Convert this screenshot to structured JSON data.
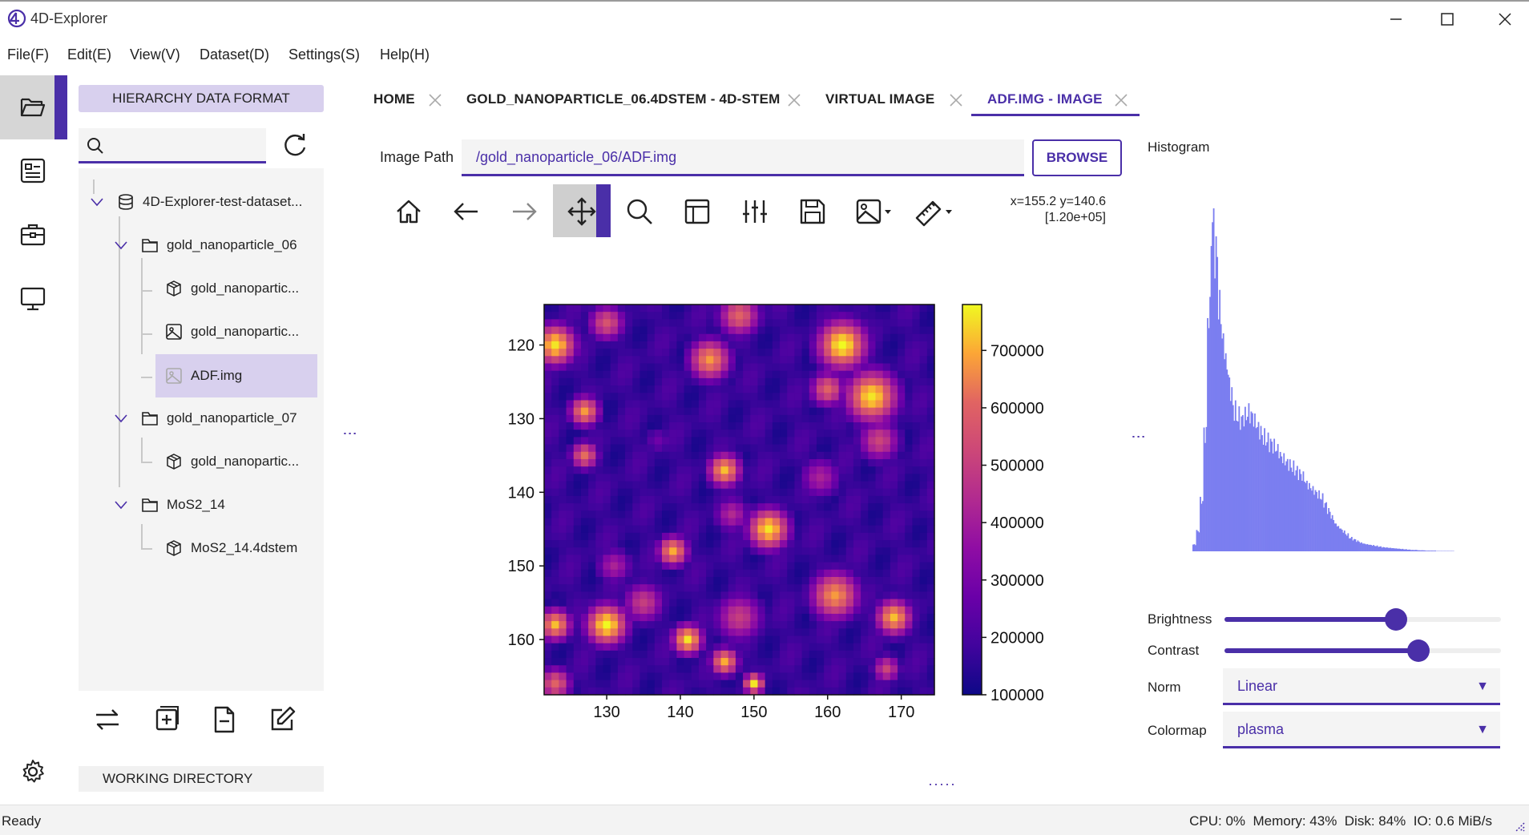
{
  "window": {
    "title": "4D-Explorer",
    "logo": "4D"
  },
  "menu": [
    "File(F)",
    "Edit(E)",
    "View(V)",
    "Dataset(D)",
    "Settings(S)",
    "Help(H)"
  ],
  "left_panel": {
    "header": "HIERARCHY DATA FORMAT",
    "search_placeholder": "",
    "working_dir": "WORKING DIRECTORY",
    "tree": [
      {
        "label": "4D-Explorer-test-dataset...",
        "icon": "database-icon",
        "level": 0
      },
      {
        "label": "gold_nanoparticle_06",
        "icon": "folder-icon",
        "level": 1
      },
      {
        "label": "gold_nanopartic...",
        "icon": "cube-icon",
        "level": 2
      },
      {
        "label": "gold_nanopartic...",
        "icon": "image-icon",
        "level": 2
      },
      {
        "label": "ADF.img",
        "icon": "image-icon",
        "level": 2,
        "selected": true
      },
      {
        "label": "gold_nanoparticle_07",
        "icon": "folder-icon",
        "level": 1
      },
      {
        "label": "gold_nanopartic...",
        "icon": "cube-icon",
        "level": 2
      },
      {
        "label": "MoS2_14",
        "icon": "folder-icon",
        "level": 1
      },
      {
        "label": "MoS2_14.4dstem",
        "icon": "cube-icon",
        "level": 2
      }
    ]
  },
  "tabs": [
    {
      "label": "HOME"
    },
    {
      "label": "GOLD_NANOPARTICLE_06.4DSTEM - 4D-STEM"
    },
    {
      "label": "VIRTUAL IMAGE"
    },
    {
      "label": "ADF.IMG - IMAGE",
      "active": true
    }
  ],
  "image_path": {
    "label": "Image Path",
    "value": "/gold_nanoparticle_06/ADF.img",
    "browse": "BROWSE"
  },
  "toolbar": {
    "icons": [
      "home-icon",
      "back-icon",
      "forward-icon",
      "pan-icon",
      "zoom-icon",
      "subplots-icon",
      "customize-icon",
      "save-icon",
      "image-icon",
      "ruler-icon"
    ],
    "coords_line1": "x=155.2 y=140.6",
    "coords_line2": "[1.20e+05]"
  },
  "chart_data": {
    "type": "heatmap",
    "title": "",
    "colormap": "plasma",
    "x_ticks": [
      130,
      140,
      150,
      160,
      170
    ],
    "y_ticks": [
      120,
      130,
      140,
      150,
      160
    ],
    "xlim": [
      121.5,
      174.5
    ],
    "ylim": [
      114.5,
      167.5
    ],
    "colorbar_ticks": [
      100000,
      200000,
      300000,
      400000,
      500000,
      600000,
      700000
    ],
    "colorbar_tick_labels": [
      "100000",
      "200000",
      "300000",
      "400000",
      "500000",
      "600000",
      "700000"
    ],
    "colorbar_range": [
      100000,
      780000
    ],
    "blobs": [
      {
        "x": 123,
        "y": 120,
        "r": 3,
        "v": 760000
      },
      {
        "x": 130,
        "y": 117,
        "r": 2.6,
        "v": 560000
      },
      {
        "x": 127,
        "y": 129,
        "r": 2.2,
        "v": 680000
      },
      {
        "x": 127,
        "y": 135,
        "r": 2,
        "v": 620000
      },
      {
        "x": 144,
        "y": 122,
        "r": 3,
        "v": 680000
      },
      {
        "x": 148,
        "y": 116,
        "r": 3,
        "v": 600000
      },
      {
        "x": 162,
        "y": 120,
        "r": 3.6,
        "v": 780000
      },
      {
        "x": 166,
        "y": 127,
        "r": 3.8,
        "v": 760000
      },
      {
        "x": 160,
        "y": 126,
        "r": 2.5,
        "v": 600000
      },
      {
        "x": 167,
        "y": 133,
        "r": 3,
        "v": 520000
      },
      {
        "x": 146,
        "y": 137,
        "r": 2.4,
        "v": 720000
      },
      {
        "x": 152,
        "y": 145,
        "r": 3,
        "v": 760000
      },
      {
        "x": 147,
        "y": 143,
        "r": 2.6,
        "v": 440000
      },
      {
        "x": 139,
        "y": 148,
        "r": 2.2,
        "v": 700000
      },
      {
        "x": 135,
        "y": 155,
        "r": 3,
        "v": 500000
      },
      {
        "x": 131,
        "y": 150,
        "r": 2.6,
        "v": 420000
      },
      {
        "x": 130,
        "y": 158,
        "r": 3,
        "v": 780000
      },
      {
        "x": 141,
        "y": 160,
        "r": 2.2,
        "v": 760000
      },
      {
        "x": 148,
        "y": 157,
        "r": 3.5,
        "v": 500000
      },
      {
        "x": 146,
        "y": 163,
        "r": 2,
        "v": 700000
      },
      {
        "x": 161,
        "y": 154,
        "r": 3.5,
        "v": 680000
      },
      {
        "x": 169,
        "y": 157,
        "r": 2.6,
        "v": 720000
      },
      {
        "x": 168,
        "y": 164,
        "r": 2,
        "v": 520000
      },
      {
        "x": 123,
        "y": 158,
        "r": 2.3,
        "v": 720000
      },
      {
        "x": 123,
        "y": 166,
        "r": 2.3,
        "v": 600000
      },
      {
        "x": 137,
        "y": 133,
        "r": 2.2,
        "v": 280000
      },
      {
        "x": 159,
        "y": 138,
        "r": 3,
        "v": 420000
      },
      {
        "x": 150,
        "y": 166,
        "r": 1.5,
        "v": 760000
      }
    ]
  },
  "histogram": {
    "title": "Histogram",
    "color": "#7b7ef0",
    "bins": [
      0.02,
      0.06,
      0.15,
      0.35,
      0.7,
      0.97,
      0.88,
      0.72,
      0.62,
      0.55,
      0.48,
      0.42,
      0.4,
      0.39,
      0.4,
      0.41,
      0.4,
      0.38,
      0.36,
      0.34,
      0.33,
      0.32,
      0.31,
      0.3,
      0.28,
      0.27,
      0.26,
      0.25,
      0.24,
      0.23,
      0.22,
      0.2,
      0.19,
      0.18,
      0.17,
      0.16,
      0.14,
      0.12,
      0.1,
      0.08,
      0.07,
      0.06,
      0.05,
      0.04,
      0.035,
      0.03,
      0.025,
      0.022,
      0.02,
      0.018,
      0.016,
      0.014,
      0.012,
      0.011,
      0.01,
      0.009,
      0.008,
      0.007,
      0.006,
      0.005,
      0.004,
      0.004,
      0.003,
      0.003,
      0.002,
      0.002,
      0.002,
      0.001,
      0.001,
      0.001,
      0.001,
      0.001,
      0.0,
      0.0,
      0.0
    ]
  },
  "controls": {
    "brightness_label": "Brightness",
    "brightness_value": 0.62,
    "contrast_label": "Contrast",
    "contrast_value": 0.7,
    "norm_label": "Norm",
    "norm_value": "Linear",
    "colormap_label": "Colormap",
    "colormap_value": "plasma"
  },
  "status": {
    "left": "Ready",
    "right": "CPU: 0%  Memory: 43%  Disk: 84%  IO: 0.6 MiB/s"
  },
  "colors": {
    "accent": "#4a2fa8",
    "selected_bg": "#d8d0ee"
  }
}
